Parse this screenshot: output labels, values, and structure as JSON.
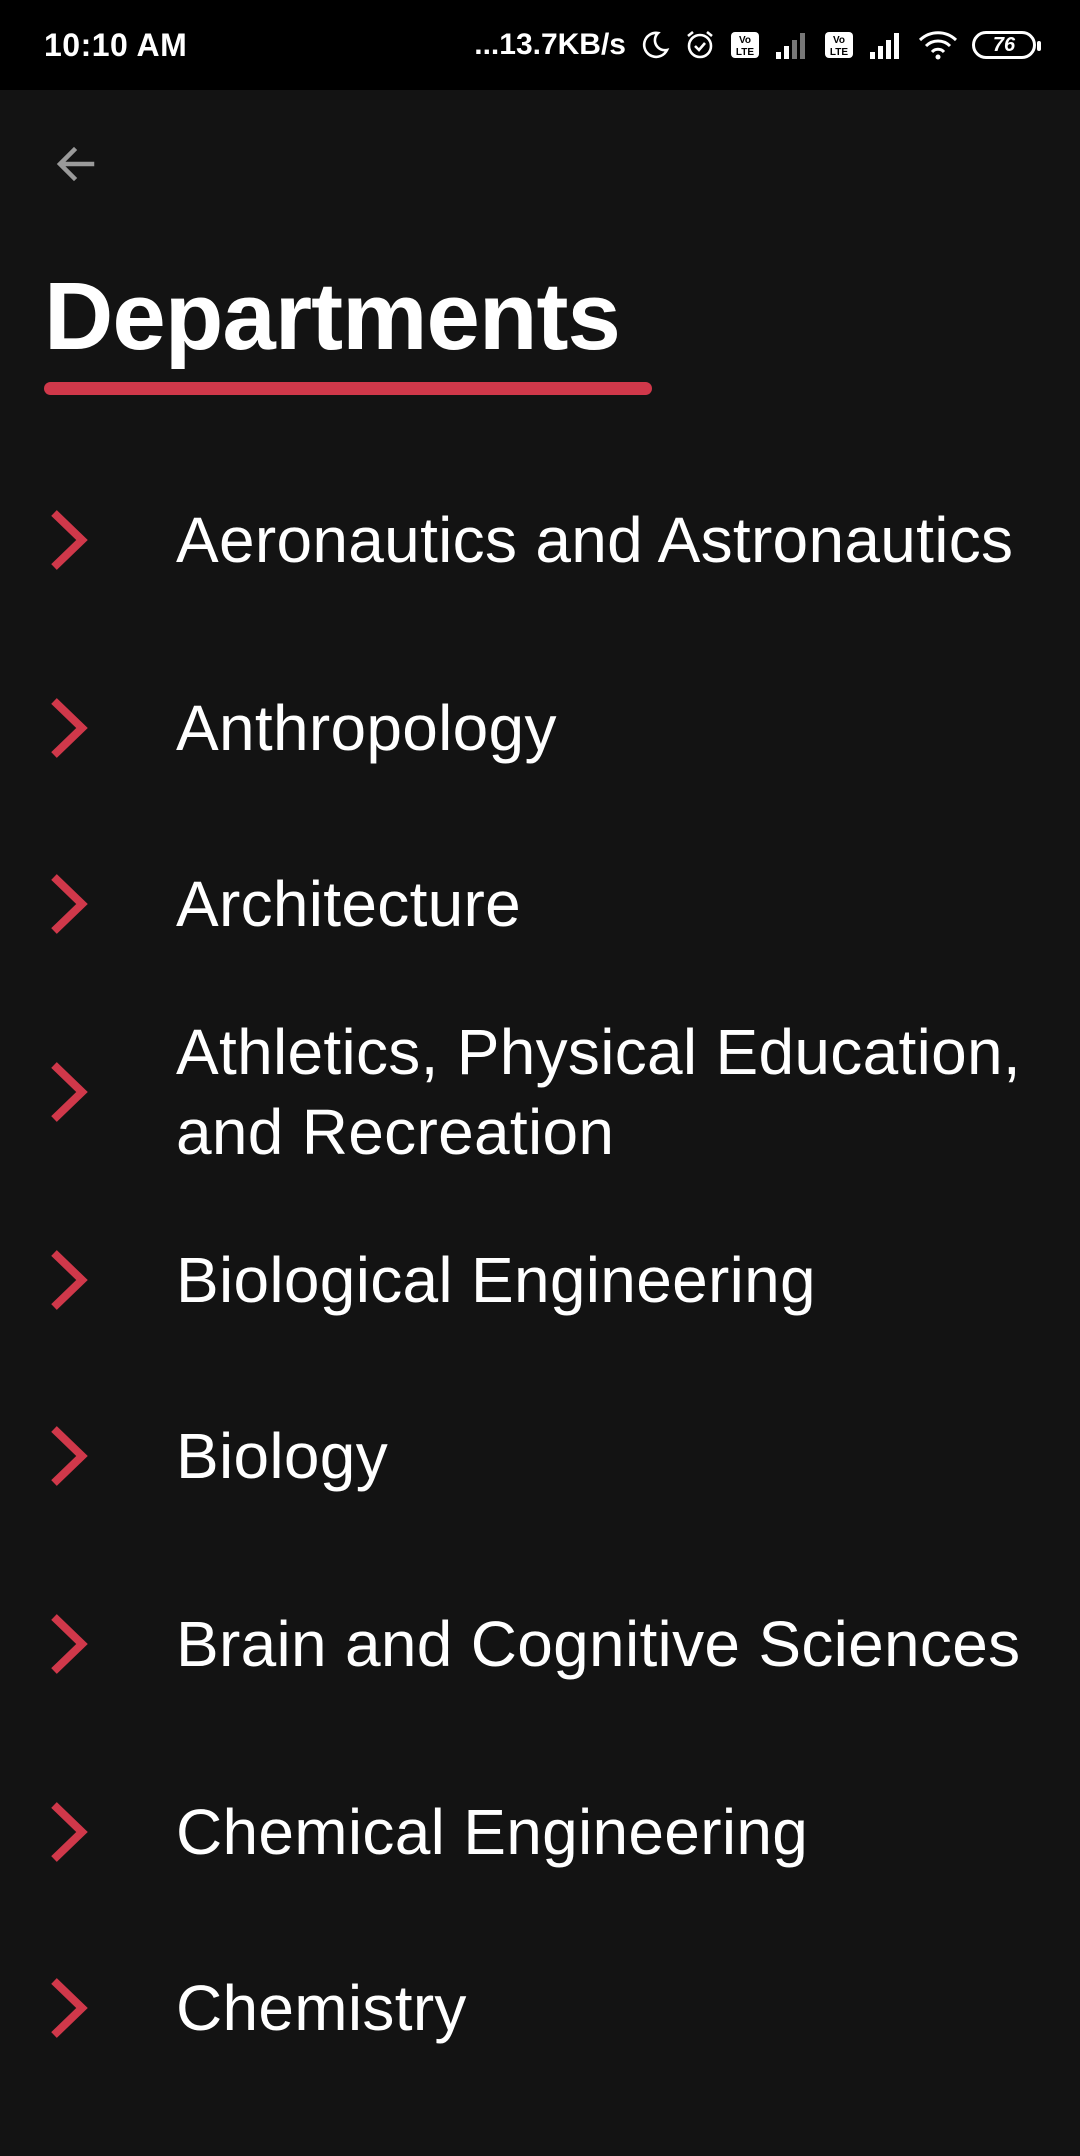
{
  "status_bar": {
    "time": "10:10 AM",
    "network_speed": "...13.7KB/s",
    "battery_level": "76",
    "icons": [
      "moon-icon",
      "alarm-icon",
      "volte-icon",
      "signal-icon",
      "volte-icon",
      "signal-icon",
      "wifi-icon",
      "battery-icon"
    ]
  },
  "header": {
    "back_icon": "arrow-left-icon",
    "title": "Departments"
  },
  "colors": {
    "background": "#131313",
    "accent": "#d0384a",
    "text": "#ffffff",
    "back_icon": "#9a9a9a"
  },
  "departments": [
    {
      "label": "Aeronautics and Astronautics",
      "icon": "chevron-right-icon"
    },
    {
      "label": "Anthropology",
      "icon": "chevron-right-icon"
    },
    {
      "label": "Architecture",
      "icon": "chevron-right-icon"
    },
    {
      "label": "Athletics, Physical Education, and Recreation",
      "icon": "chevron-right-icon"
    },
    {
      "label": "Biological Engineering",
      "icon": "chevron-right-icon"
    },
    {
      "label": "Biology",
      "icon": "chevron-right-icon"
    },
    {
      "label": "Brain and Cognitive Sciences",
      "icon": "chevron-right-icon"
    },
    {
      "label": "Chemical Engineering",
      "icon": "chevron-right-icon"
    },
    {
      "label": "Chemistry",
      "icon": "chevron-right-icon"
    }
  ]
}
